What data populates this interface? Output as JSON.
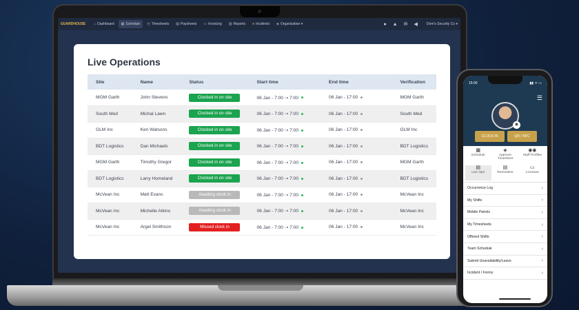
{
  "navbar": {
    "brand": "GUARDHOUSE",
    "items": [
      {
        "icon": "⌂",
        "label": "Dashboard",
        "active": false
      },
      {
        "icon": "▦",
        "label": "Schedule",
        "active": true
      },
      {
        "icon": "◷",
        "label": "Timesheets",
        "active": false
      },
      {
        "icon": "▤",
        "label": "Paysheets",
        "active": false
      },
      {
        "icon": "▭",
        "label": "Invoicing",
        "active": false
      },
      {
        "icon": "▥",
        "label": "Reports",
        "active": false
      },
      {
        "icon": "●",
        "label": "Incidents",
        "active": false
      },
      {
        "icon": "◈",
        "label": "Organization ▾",
        "active": false
      }
    ],
    "account": "Dom's Security Co ▾"
  },
  "live_operations": {
    "title": "Live Operations",
    "columns": [
      "Site",
      "Name",
      "Status",
      "Start time",
      "End time",
      "Verification"
    ],
    "rows": [
      {
        "site": "MGM Garth",
        "name": "John Stevens",
        "status": "Clocked in on site",
        "status_kind": "green",
        "start": "06 Jan - 7:00 ⇢ 7:00",
        "end": "06 Jan - 17:00",
        "verification": "MGM Garth"
      },
      {
        "site": "South Med",
        "name": "Michal Lawn",
        "status": "Clocked in on site",
        "status_kind": "green",
        "start": "06 Jan - 7:00 ⇢ 7:00",
        "end": "06 Jan - 17:00",
        "verification": "South Med"
      },
      {
        "site": "GLM Inc",
        "name": "Ken Watsons",
        "status": "Clocked in on site",
        "status_kind": "green",
        "start": "06 Jan - 7:00 ⇢ 7:00",
        "end": "06 Jan - 17:00",
        "verification": "GLM Inc"
      },
      {
        "site": "BDT Logistics",
        "name": "Dan Michaels",
        "status": "Clocked in on site",
        "status_kind": "green",
        "start": "06 Jan - 7:00 ⇢ 7:00",
        "end": "06 Jan - 17:00",
        "verification": "BDT Logistics"
      },
      {
        "site": "MGM Garth",
        "name": "Timothy Gregor",
        "status": "Clocked in on site",
        "status_kind": "green",
        "start": "06 Jan - 7:00 ⇢ 7:00",
        "end": "06 Jan - 17:00",
        "verification": "MGM Garth"
      },
      {
        "site": "BDT Logistics",
        "name": "Larry Homeland",
        "status": "Clocked in on site",
        "status_kind": "green",
        "start": "06 Jan - 7:00 ⇢ 7:00",
        "end": "06 Jan - 17:00",
        "verification": "BDT Logistics"
      },
      {
        "site": "McVean Inc",
        "name": "Matt Evans",
        "status": "Awaiting clock in",
        "status_kind": "grey",
        "start": "06 Jan - 7:00 ⇢ 7:00",
        "end": "06 Jan - 17:00",
        "verification": "McVean Inc"
      },
      {
        "site": "McVean Inc",
        "name": "Michelle Atkins",
        "status": "Awaiting clock in",
        "status_kind": "grey",
        "start": "06 Jan - 7:00 ⇢ 7:00",
        "end": "06 Jan - 17:00",
        "verification": "McVean Inc"
      },
      {
        "site": "McVean Inc",
        "name": "Argel Smithson",
        "status": "Missed clock in",
        "status_kind": "red",
        "start": "06 Jan - 7:00 ⇢ 7:00",
        "end": "06 Jan - 17:00",
        "verification": "McVean Inc"
      }
    ]
  },
  "phone": {
    "time": "15:00",
    "battery": "▮▮ ᯤ ▭",
    "buttons": [
      "CLOCK IN",
      "QR / NFC"
    ],
    "quick_links": [
      {
        "icon": "▦",
        "label": "Schedule"
      },
      {
        "icon": "◈",
        "label": "Approve Timesheet"
      },
      {
        "icon": "◉◉",
        "label": "Staff Profiles"
      },
      {
        "icon": "▤",
        "label": "Live Ops"
      },
      {
        "icon": "▤",
        "label": "Reminders"
      },
      {
        "icon": "▭",
        "label": "Licenses"
      }
    ],
    "menu": [
      "Occurrence Log",
      "My Shifts",
      "Mobile Patrols",
      "My Timesheets",
      "Offered Shifts",
      "Team Schedule",
      "Submit Unavailability/Leave",
      "Incident / Forms"
    ]
  },
  "colors": {
    "status_green": "#1ca34f",
    "status_grey": "#b9b9b9",
    "status_red": "#e32020",
    "gold": "#c8a24a"
  }
}
